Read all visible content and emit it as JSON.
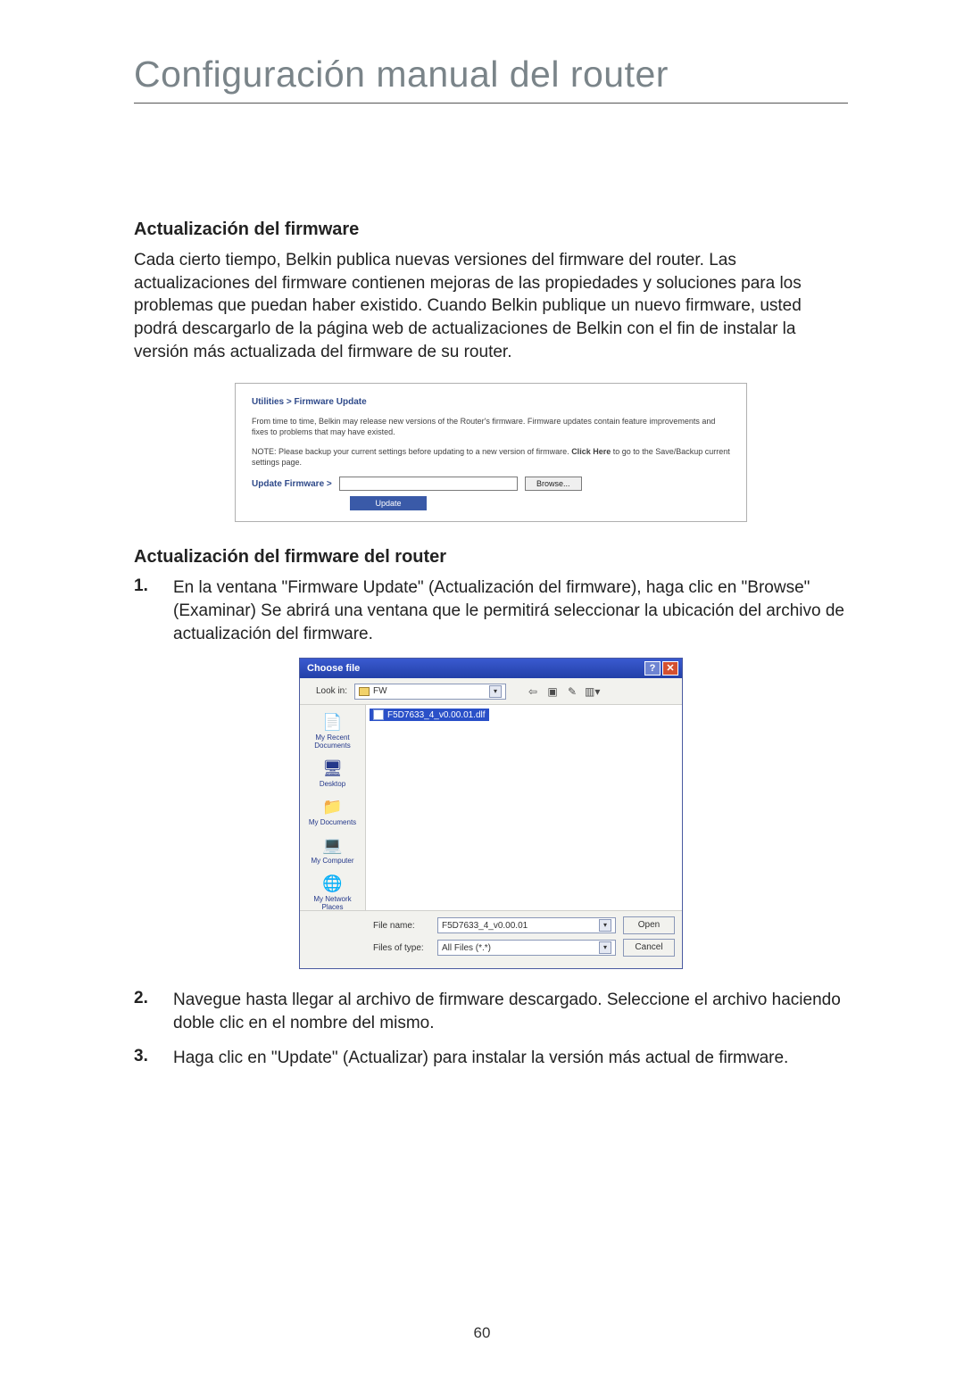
{
  "title": "Configuración manual del router",
  "section1": {
    "heading": "Actualización del firmware",
    "body": "Cada cierto tiempo, Belkin publica nuevas versiones del firmware del router. Las actualizaciones del firmware contienen mejoras de las propiedades y soluciones para los problemas que puedan haber existido. Cuando Belkin publique un nuevo firmware, usted podrá descargarlo de la página web de actualizaciones de Belkin con el fin de instalar la versión más actualizada del firmware de su router."
  },
  "figure1": {
    "breadcrumb": "Utilities > Firmware Update",
    "desc": "From time to time, Belkin may release new versions of the Router's firmware. Firmware updates contain feature improvements and fixes to problems that may have existed.",
    "note_pre": "NOTE: Please backup your current settings before updating to a new version of firmware. ",
    "note_link": "Click Here",
    "note_post": " to go to the Save/Backup current settings page.",
    "update_label": "Update Firmware >",
    "browse_label": "Browse...",
    "update_btn": "Update"
  },
  "section2": {
    "heading": "Actualización del firmware del router",
    "items": [
      {
        "num": "1.",
        "text": "En la ventana \"Firmware Update\" (Actualización del firmware), haga clic en \"Browse\" (Examinar) Se abrirá una ventana que le permitirá seleccionar la ubicación del archivo de actualización del firmware."
      },
      {
        "num": "2.",
        "text": "Navegue hasta llegar al archivo de firmware descargado. Seleccione el archivo haciendo doble clic en el nombre del mismo."
      },
      {
        "num": "3.",
        "text": "Haga clic en \"Update\" (Actualizar) para instalar la versión más actual de firmware."
      }
    ]
  },
  "figure2": {
    "title": "Choose file",
    "help": "?",
    "close": "✕",
    "lookin_label": "Look in:",
    "lookin_value": "FW",
    "toolbar_icons": [
      "⇦",
      "▣",
      "✎",
      "▥▾"
    ],
    "places": [
      {
        "icon": "📄",
        "label": "My Recent Documents"
      },
      {
        "icon": "🖥",
        "label": "Desktop"
      },
      {
        "icon": "📁",
        "label": "My Documents"
      },
      {
        "icon": "💻",
        "label": "My Computer"
      },
      {
        "icon": "🌐",
        "label": "My Network Places"
      }
    ],
    "selected_file": "F5D7633_4_v0.00.01.dlf",
    "filename_label": "File name:",
    "filename_value": "F5D7633_4_v0.00.01",
    "filetype_label": "Files of type:",
    "filetype_value": "All Files (*.*)",
    "open_btn": "Open",
    "cancel_btn": "Cancel"
  },
  "page_number": "60"
}
